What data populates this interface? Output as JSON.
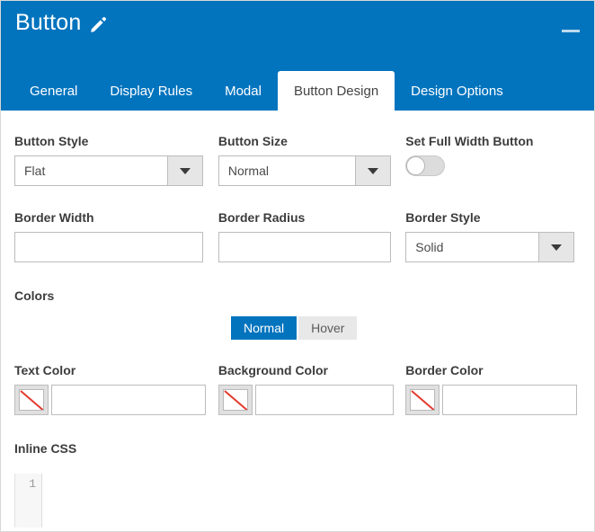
{
  "window": {
    "title": "Button",
    "title_icon": "pencil-icon",
    "minimize_icon": "minimize-icon",
    "accent_color": "#0274be",
    "content_background": "#ffffff"
  },
  "tabs": [
    {
      "label": "General",
      "active": false
    },
    {
      "label": "Display Rules",
      "active": false
    },
    {
      "label": "Modal",
      "active": false
    },
    {
      "label": "Button Design",
      "active": true
    },
    {
      "label": "Design Options",
      "active": false
    }
  ],
  "fields": {
    "button_style": {
      "label": "Button Style",
      "value": "Flat",
      "type": "select"
    },
    "button_size": {
      "label": "Button Size",
      "value": "Normal",
      "type": "select"
    },
    "full_width": {
      "label": "Set Full Width Button",
      "state": "off",
      "type": "toggle"
    },
    "border_width": {
      "label": "Border Width",
      "value": "",
      "placeholder": "",
      "type": "text"
    },
    "border_radius": {
      "label": "Border Radius",
      "value": "",
      "placeholder": "",
      "type": "text"
    },
    "border_style": {
      "label": "Border Style",
      "value": "Solid",
      "type": "select"
    }
  },
  "colors": {
    "section_label": "Colors",
    "state_tabs": [
      {
        "label": "Normal",
        "active": true
      },
      {
        "label": "Hover",
        "active": false
      }
    ],
    "text_color": {
      "label": "Text Color",
      "value": "",
      "placeholder": "",
      "swatch": "none"
    },
    "background_color": {
      "label": "Background Color",
      "value": "",
      "placeholder": "",
      "swatch": "none"
    },
    "border_color": {
      "label": "Border Color",
      "value": "",
      "placeholder": "",
      "swatch": "none"
    }
  },
  "inline_css": {
    "label": "Inline CSS",
    "line_numbers": [
      "1"
    ],
    "content": ""
  }
}
